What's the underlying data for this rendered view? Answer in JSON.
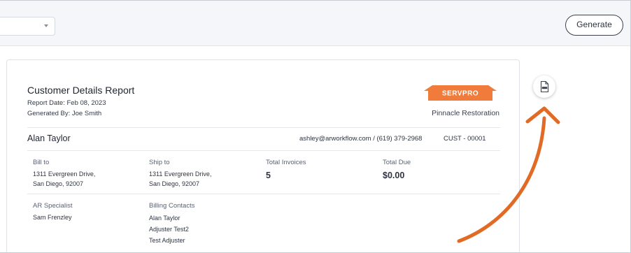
{
  "toolbar": {
    "generate_label": "Generate"
  },
  "report": {
    "title": "Customer Details Report",
    "report_date": "Report Date: Feb 08, 2023",
    "generated_by": "Generated By: Joe Smith",
    "logo_text": "SERVPRO",
    "company_name": "Pinnacle Restoration"
  },
  "customer": {
    "name": "Alan Taylor",
    "contact": "ashley@arworkflow.com / (619) 379-2968",
    "id": "CUST - 00001"
  },
  "details": {
    "bill_to_label": "Bill to",
    "bill_to_line1": "1311 Evergreen Drive,",
    "bill_to_line2": "San Diego, 92007",
    "ship_to_label": "Ship to",
    "ship_to_line1": "1311 Evergreen Drive,",
    "ship_to_line2": "San Diego, 92007",
    "total_invoices_label": "Total Invoices",
    "total_invoices_value": "5",
    "total_due_label": "Total Due",
    "total_due_value": "$0.00",
    "ar_specialist_label": "AR Specialist",
    "ar_specialist_value": "Sam Frenzley",
    "billing_contacts_label": "Billing Contacts",
    "billing_contacts": [
      "Alan Taylor",
      "Adjuster Test2",
      "Test Adjuster"
    ]
  },
  "icons": {
    "pdf": "pdf-icon",
    "dropdown": "chevron-down-icon",
    "arrow": "annotation-arrow-icon"
  },
  "colors": {
    "brand_orange": "#f07b3a",
    "arrow_orange": "#e16a24",
    "text_dark": "#1f2430"
  }
}
